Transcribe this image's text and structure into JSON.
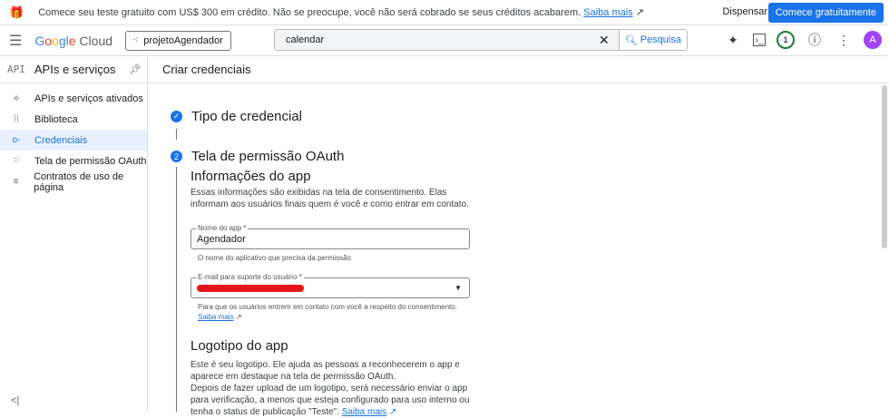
{
  "banner": {
    "text": "Comece seu teste gratuito com US$ 300 em crédito. Não se preocupe, você não será cobrado se seus créditos acabarem.",
    "link": "Saiba mais",
    "dismiss": "Dispensar",
    "start": "Comece gratuitamente"
  },
  "topbar": {
    "logo": "Google Cloud",
    "project": "projetoAgendador",
    "search_value": "calendar",
    "search_button": "Pesquisa",
    "notifications": "1",
    "avatar": "A"
  },
  "sidebar": {
    "api_label": "API",
    "title": "APIs e serviços",
    "items": [
      {
        "label": "APIs e serviços ativados",
        "icon": "⟡"
      },
      {
        "label": "Biblioteca",
        "icon": "⁞⁞"
      },
      {
        "label": "Credenciais",
        "icon": "o-"
      },
      {
        "label": "Tela de permissão OAuth",
        "icon": "⁙"
      },
      {
        "label": "Contratos de uso de página",
        "icon": "≡"
      }
    ],
    "collapse": "<|"
  },
  "main": {
    "title": "Criar credenciais",
    "step1": "Tipo de credencial",
    "step2_num": "2",
    "step2": "Tela de permissão OAuth",
    "app_info": {
      "heading": "Informações do app",
      "desc": "Essas informações são exibidas na tela de consentimento. Elas informam aos usuários finais quem é você e como entrar em contato.",
      "name_label": "Nome do app *",
      "name_value": "Agendador",
      "name_hint": "O nome do aplicativo que precisa da permissão",
      "email_label": "E-mail para suporte do usuário *",
      "email_hint": "Para que os usuários entrem em contato com você a respeito do consentimento.",
      "email_link": "Saiba mais"
    },
    "logo": {
      "heading": "Logotipo do app",
      "desc1": "Este é seu logotipo. Ele ajuda as pessoas a reconhecerem o app e aparece em destaque na tela de permissão OAuth.",
      "desc2": "Depois de fazer upload de um logotipo, será necessário enviar o app para verificação, a menos que esteja configurado para uso interno ou tenha o status de publicação \"Teste\".",
      "link": "Saiba mais"
    }
  }
}
